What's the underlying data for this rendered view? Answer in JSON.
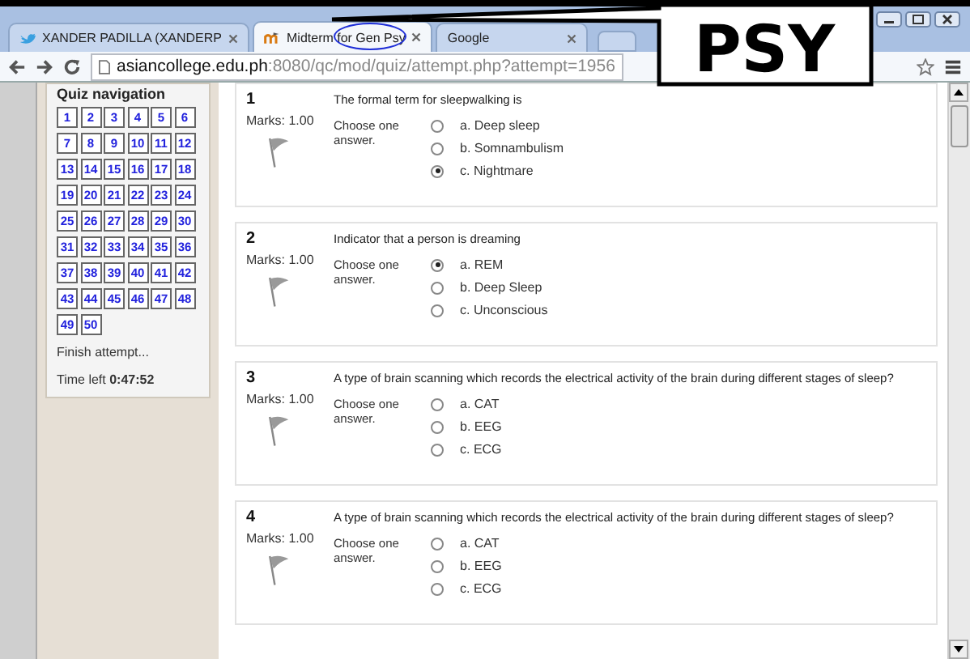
{
  "annotation": {
    "label": "PSY"
  },
  "browser": {
    "tabs": [
      {
        "label": "XANDER PADILLA (XANDERP",
        "selected": false,
        "kind": "social",
        "highlighted": false
      },
      {
        "label": "Midterm for Gen Psy",
        "selected": true,
        "kind": "quiz",
        "highlighted": true
      },
      {
        "label": "Google",
        "selected": false,
        "kind": "plain",
        "highlighted": false
      }
    ],
    "url_host": "asiancollege.edu.ph",
    "url_path": ":8080/qc/mod/quiz/attempt.php?attempt=1956"
  },
  "quiz_navigation": {
    "title": "Quiz navigation",
    "questions": [
      "1",
      "2",
      "3",
      "4",
      "5",
      "6",
      "7",
      "8",
      "9",
      "10",
      "11",
      "12",
      "13",
      "14",
      "15",
      "16",
      "17",
      "18",
      "19",
      "20",
      "21",
      "22",
      "23",
      "24",
      "25",
      "26",
      "27",
      "28",
      "29",
      "30",
      "31",
      "32",
      "33",
      "34",
      "35",
      "36",
      "37",
      "38",
      "39",
      "40",
      "41",
      "42",
      "43",
      "44",
      "45",
      "46",
      "47",
      "48",
      "49",
      "50"
    ],
    "finish": "Finish attempt...",
    "time_label": "Time left",
    "time_value": "0:47:52"
  },
  "questions": [
    {
      "number": "1",
      "text": "The formal term for sleepwalking is",
      "marks": "Marks: 1.00",
      "prompt": "Choose one answer.",
      "options": [
        {
          "label": "a. Deep sleep",
          "selected": false
        },
        {
          "label": "b. Somnambulism",
          "selected": false
        },
        {
          "label": "c. Nightmare",
          "selected": true
        }
      ]
    },
    {
      "number": "2",
      "text": "Indicator that a person is dreaming",
      "marks": "Marks: 1.00",
      "prompt": "Choose one answer.",
      "options": [
        {
          "label": "a. REM",
          "selected": true
        },
        {
          "label": "b. Deep Sleep",
          "selected": false
        },
        {
          "label": "c. Unconscious",
          "selected": false
        }
      ]
    },
    {
      "number": "3",
      "text": "A type of brain scanning which records the electrical activity of the brain during different stages of sleep?",
      "marks": "Marks: 1.00",
      "prompt": "Choose one answer.",
      "options": [
        {
          "label": "a. CAT",
          "selected": false
        },
        {
          "label": "b. EEG",
          "selected": false
        },
        {
          "label": "c. ECG",
          "selected": false
        }
      ]
    },
    {
      "number": "4",
      "text": "A type of brain scanning which records the electrical activity of the brain during different stages of sleep?",
      "marks": "Marks: 1.00",
      "prompt": "Choose one answer.",
      "options": [
        {
          "label": "a. CAT",
          "selected": false
        },
        {
          "label": "b. EEG",
          "selected": false
        },
        {
          "label": "c. ECG",
          "selected": false
        }
      ]
    }
  ]
}
